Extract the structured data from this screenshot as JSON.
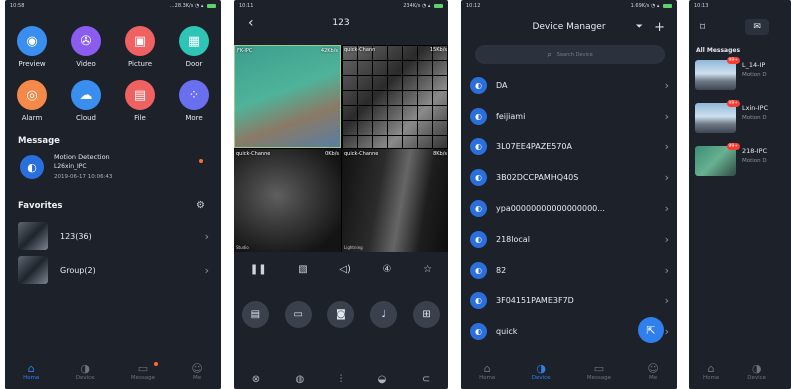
{
  "screen1": {
    "status": {
      "time": "10:58",
      "right": "...28.3K/s"
    },
    "apps": [
      {
        "label": "Preview",
        "color": "#3a8ef0",
        "icon": "◉"
      },
      {
        "label": "Video",
        "color": "#8a5cf0",
        "icon": "✇"
      },
      {
        "label": "Picture",
        "color": "#f06161",
        "icon": "▣"
      },
      {
        "label": "Door",
        "color": "#2ec4b6",
        "icon": "▦"
      },
      {
        "label": "Alarm",
        "color": "#f5894a",
        "icon": "◎"
      },
      {
        "label": "Cloud",
        "color": "#3a8ef0",
        "icon": "☁"
      },
      {
        "label": "File",
        "color": "#f06161",
        "icon": "▤"
      },
      {
        "label": "More",
        "color": "#6a6ff0",
        "icon": "⁘"
      }
    ],
    "message_title": "Message",
    "message": {
      "event": "Motion Detection",
      "device": "L26xin_IPC",
      "datetime": "2019-06-17 10:06:43"
    },
    "favorites_title": "Favorites",
    "favorites": [
      {
        "label": "123(36)"
      },
      {
        "label": "Group(2)"
      }
    ]
  },
  "screen2": {
    "status": {
      "time": "10:11",
      "right": "234K/s"
    },
    "title": "123",
    "videos": [
      {
        "name": "FK-IPC",
        "rate": "42Kb/s",
        "caption": ""
      },
      {
        "name": "quick-Chann",
        "rate": "15Kb/s",
        "caption": ""
      },
      {
        "name": "quick-Channe",
        "rate": "0Kb/s",
        "caption": "Studio"
      },
      {
        "name": "quick-Channe",
        "rate": "8Kb/s",
        "caption": "Lightning"
      }
    ]
  },
  "screen3": {
    "status": {
      "time": "10:12",
      "right": "1.69K/s"
    },
    "title": "Device Manager",
    "search_placeholder": "Search Device",
    "devices": [
      {
        "label": "DA"
      },
      {
        "label": "feijiami"
      },
      {
        "label": "3L07EE4PAZE570A"
      },
      {
        "label": "3B02DCCPAMHQ40S"
      },
      {
        "label": "ypa00000000000000000..."
      },
      {
        "label": "218local"
      },
      {
        "label": "82"
      },
      {
        "label": "3F04151PAME3F7D"
      },
      {
        "label": "quick"
      }
    ]
  },
  "screen4": {
    "status": {
      "time": "10:13"
    },
    "section": "All Messages",
    "messages": [
      {
        "title": "L_14-IP",
        "sub": "Motion D",
        "badge": "99+"
      },
      {
        "title": "Lxin-IPC",
        "sub": "Motion D",
        "badge": "99+"
      },
      {
        "title": "218-IPC",
        "sub": "Motion D",
        "badge": "99+"
      }
    ]
  },
  "tabs": {
    "home": "Home",
    "device": "Device",
    "message": "Message",
    "me": "Me"
  }
}
